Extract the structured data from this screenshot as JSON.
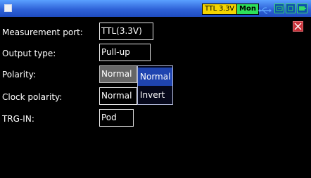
{
  "status_bar": {
    "ttl_badge": "TTL 3.3V",
    "mon_badge": "Mon",
    "icons": [
      "menu-square-icon",
      "usb-icon",
      "screen-icon",
      "record-icon",
      "battery-icon"
    ],
    "colors": {
      "bar": "#2f63d8",
      "ttl_badge_bg": "#f3d400",
      "mon_badge_bg": "#2ee05a"
    }
  },
  "form": {
    "measurement_port": {
      "label": "Measurement port:",
      "value": "TTL(3.3V)"
    },
    "output_type": {
      "label": "Output type:",
      "value": "Pull-up"
    },
    "polarity": {
      "label": "Polarity:",
      "value": "Normal"
    },
    "clock_polarity": {
      "label": "Clock polarity:",
      "value": "Normal"
    },
    "trg_in": {
      "label": "TRG-IN:",
      "value": "Pod"
    }
  },
  "dropdown": {
    "options": [
      "Normal",
      "Invert"
    ],
    "highlighted": "Normal"
  },
  "close_icon": "close-icon"
}
